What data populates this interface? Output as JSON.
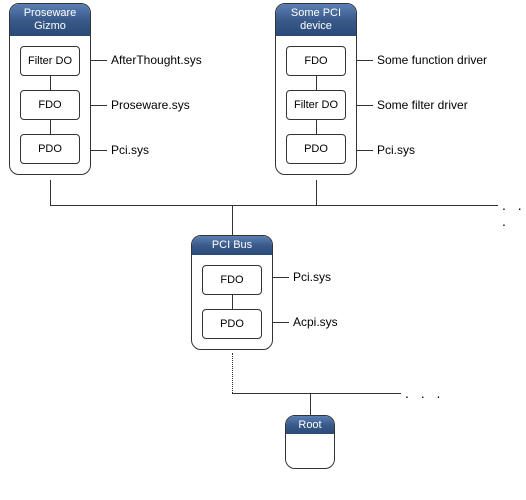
{
  "devices": {
    "proseware": {
      "title": "Proseware Gizmo",
      "stack": [
        {
          "box": "Filter DO",
          "driver": "AfterThought.sys"
        },
        {
          "box": "FDO",
          "driver": "Proseware.sys"
        },
        {
          "box": "PDO",
          "driver": "Pci.sys"
        }
      ]
    },
    "somepci": {
      "title": "Some PCI device",
      "stack": [
        {
          "box": "FDO",
          "driver": "Some function driver"
        },
        {
          "box": "Filter DO",
          "driver": "Some filter driver"
        },
        {
          "box": "PDO",
          "driver": "Pci.sys"
        }
      ]
    },
    "pcibus": {
      "title": "PCI Bus",
      "stack": [
        {
          "box": "FDO",
          "driver": "Pci.sys"
        },
        {
          "box": "PDO",
          "driver": "Acpi.sys"
        }
      ]
    },
    "root": {
      "title": "Root"
    }
  },
  "ellipsis": ". . ."
}
